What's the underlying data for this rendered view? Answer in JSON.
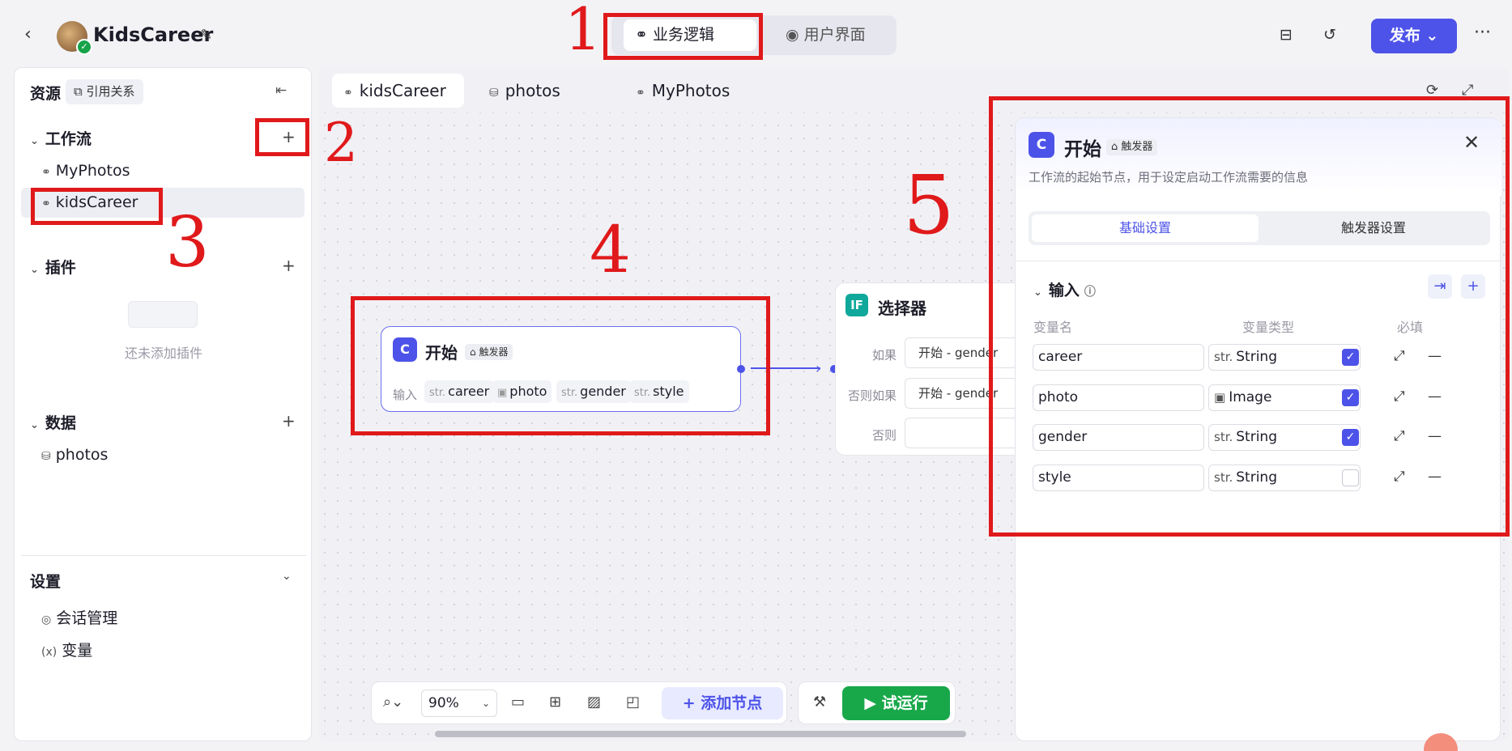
{
  "header": {
    "back_icon": "chevron-left-icon",
    "app_title": "KidsCareer",
    "mode_tabs": [
      "业务逻辑",
      "用户界面"
    ],
    "publish_label": "发布",
    "colors": {
      "accent": "#4d53e8",
      "run": "#18a84a",
      "annotation": "#e0191b"
    }
  },
  "sidebar": {
    "title": "资源",
    "ref_label": "引用关系",
    "sections": {
      "workflow": {
        "label": "工作流",
        "items": [
          "MyPhotos",
          "kidsCareer"
        ]
      },
      "plugins": {
        "label": "插件",
        "empty_text": "还未添加插件"
      },
      "data": {
        "label": "数据",
        "items": [
          "photos"
        ]
      },
      "settings": {
        "label": "设置",
        "items": [
          "会话管理",
          "变量"
        ]
      }
    }
  },
  "canvas": {
    "tabs": [
      "kidsCareer",
      "photos",
      "MyPhotos"
    ],
    "start_node": {
      "title": "开始",
      "badge": "触发器",
      "inputs_label": "输入",
      "vars": [
        {
          "type": "str.",
          "name": "career"
        },
        {
          "type": "img",
          "name": "photo"
        },
        {
          "type": "str.",
          "name": "gender"
        },
        {
          "type": "str.",
          "name": "style"
        }
      ]
    },
    "selector_node": {
      "icon": "IF",
      "title": "选择器",
      "conditions": [
        {
          "label": "如果",
          "value": "开始  -  gender"
        },
        {
          "label": "否则如果",
          "value": "开始  -  gender"
        },
        {
          "label": "否则",
          "value": ""
        }
      ]
    }
  },
  "panel": {
    "title": "开始",
    "badge": "触发器",
    "description": "工作流的起始节点，用于设定启动工作流需要的信息",
    "tabs": [
      "基础设置",
      "触发器设置"
    ],
    "section_title": "输入",
    "columns": [
      "变量名",
      "变量类型",
      "必填"
    ],
    "rows": [
      {
        "name": "career",
        "type_prefix": "str.",
        "type": "String",
        "required": true
      },
      {
        "name": "photo",
        "type_prefix": "img",
        "type": "Image",
        "required": true
      },
      {
        "name": "gender",
        "type_prefix": "str.",
        "type": "String",
        "required": true
      },
      {
        "name": "style",
        "type_prefix": "str.",
        "type": "String",
        "required": false
      }
    ]
  },
  "toolbar": {
    "zoom": "90%",
    "add_node_label": "添加节点",
    "run_label": "试运行"
  },
  "annotations": [
    "1",
    "2",
    "3",
    "4",
    "5"
  ]
}
